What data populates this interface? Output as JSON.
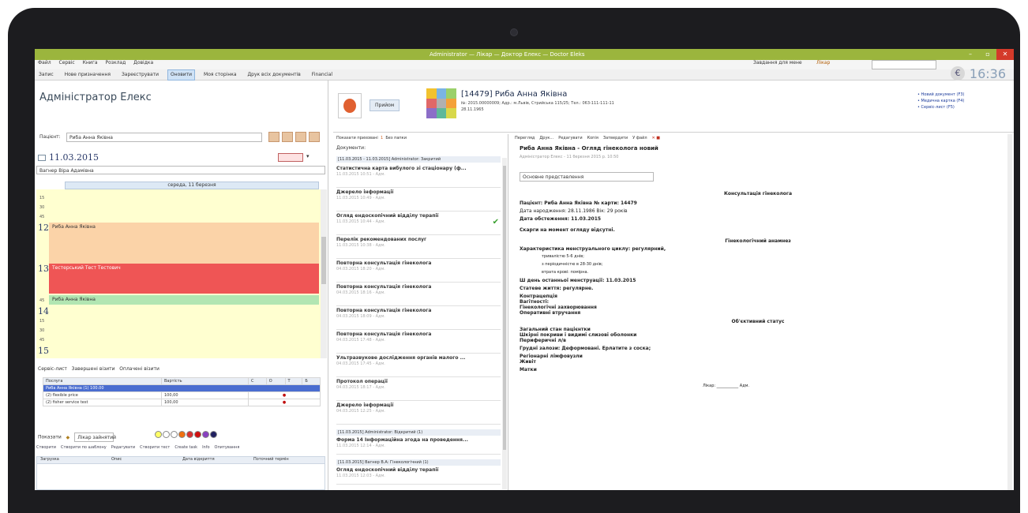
{
  "window": {
    "title": "Administrator — Лікар — Доктор Елекс — Doctor Eleks"
  },
  "menu": {
    "items": [
      "Файл",
      "Сервіс",
      "Книга",
      "Розклад",
      "Довідка"
    ]
  },
  "toolbar": {
    "items": [
      "Запис",
      "Нове призначення",
      "Зареєструвати",
      "Оновити",
      "Моя сторінка",
      "Друк всіх документів",
      "Financial"
    ]
  },
  "top_right": {
    "today_label": "Завдання для мене",
    "user": "Лікар",
    "clock": "16:36",
    "links": [
      "Новий документ (F3)",
      "Медична картка (F4)",
      "Сервіс-лист (F5)"
    ]
  },
  "left": {
    "header": "Адміністратор Елекс",
    "patient_label": "Пацієнт:",
    "patient_value": "Риба Анна Яківна",
    "date": "11.03.2015",
    "doctor_select": "Вагнер Віра Адамівна",
    "day_header": "середа, 11 березня",
    "hours": [
      "12",
      "13",
      "14",
      "15"
    ],
    "minutes": [
      "15",
      "30",
      "45"
    ],
    "appointments": [
      "Риба Анна Яківна",
      "Тестерський Тест Тестович",
      "Риба Анна Яківна"
    ],
    "services_tabs": [
      "Сервіс-лист",
      "Завершені візити",
      "Оплачені візити"
    ],
    "services_table": {
      "columns": [
        "Послуга",
        "Вартість",
        "С",
        "О",
        "Т",
        "Б"
      ],
      "group_row": "Риба Анна Яківна (1) 100.00",
      "rows": [
        {
          "name": "(2) flexible price",
          "price": "100,00"
        },
        {
          "name": "(2) fisher service test",
          "price": "100,00"
        }
      ]
    },
    "show_label": "Показати",
    "doctor_filter": "Лікар зайнятий",
    "colors": [
      "#ffff66",
      "#ffffff",
      "#ffffff",
      "#f07010",
      "#d83030",
      "#d01010",
      "#8840c0",
      "#202060"
    ],
    "bottom_toolbar": [
      "Створити",
      "Створити по шаблону",
      "Редагувати",
      "Створити тест",
      "Create task",
      "Info",
      "Опитування"
    ],
    "bottom_columns": [
      "Загрузка",
      "Опис",
      "Дата відкриття",
      "Поточний термін"
    ]
  },
  "patient": {
    "name": "[14479] Риба Анна Яківна",
    "details": "№: 2015.00000009; Адр.: м.Львів, Стрийська 115/25; Тел.: 063-111-111-11",
    "dob": "28.11.1965",
    "history_button": "Прийом"
  },
  "middle": {
    "toolbar": [
      "Показати приховані",
      "1",
      "Без папки"
    ],
    "section_label": "Документи:",
    "group1": "[11.03.2015 - 11.03.2015] Administrator: Закритий",
    "items": [
      {
        "title": "Статистична карта вибулого зі стаціонару (ф...",
        "sub": "11.03.2015 10:51 - Адм."
      },
      {
        "title": "Джерело інформації",
        "sub": "11.03.2015 10:49 - Адм."
      },
      {
        "title": "Огляд ендоскопічний відділу терапії",
        "sub": "11.03.2015 10:44 - Адм."
      },
      {
        "title": "Перелік рекомендованих послуг",
        "sub": "11.03.2015 10:38 - Адм."
      },
      {
        "title": "Повторна консультація гінеколога",
        "sub": "04.03.2015 18:20 - Адм."
      },
      {
        "title": "Повторна консультація гінеколога",
        "sub": "04.03.2015 18:16 - Адм."
      },
      {
        "title": "Повторна консультація гінеколога",
        "sub": "04.03.2015 18:09 - Адм."
      },
      {
        "title": "Повторна консультація гінеколога",
        "sub": "04.03.2015 17:48 - Адм."
      },
      {
        "title": "Ультразвукове дослідження органів малого ...",
        "sub": "04.03.2015 17:45 - Адм."
      },
      {
        "title": "Протокол операції",
        "sub": "04.03.2015 18:17 - Адм."
      },
      {
        "title": "Джерело інформації",
        "sub": "04.03.2015 12:25 - Адм."
      }
    ],
    "group2": "[11.03.2015] Administrator: Відкритий (1)",
    "item_after_group2": {
      "title": "Форма 14 Інформаційна згода на проведення...",
      "sub": "11.03.2015 12:14 - Адм."
    },
    "group3": "[11.03.2015] Вагнер В.А: Гінекологічний (1)",
    "item_after_group3": {
      "title": "Огляд ендоскопічний відділу терапії",
      "sub": "11.03.2015 12:03 - Адм."
    }
  },
  "document": {
    "toolbar": [
      "Перегляд",
      "Друк...",
      "Редагувати",
      "Копія",
      "Затвердити",
      "У файл"
    ],
    "title": "Риба Анна Яківна - Огляд гінеколога новий",
    "subtitle": "Адміністратор Елекс - 11 березня 2015 р. 10:50",
    "view_select": "Основне представлення",
    "heading": "Консультація гінеколога",
    "patient_line": "Пацієнт: Риба Анна Яківна   № карти: 14479",
    "dob_line": "Дата народження: 28.11.1986   Вік: 29 років",
    "exam_date": "Дата обстеження: 11.03.2015",
    "complaints": "Скарги на момент огляду відсутні.",
    "history_heading": "Гінекологічний анамнез",
    "cycle_line": "Характеристика менструального циклу: регулярний,",
    "cycle_details": [
      "тривалістю 5-6 днів;",
      "з періодичністю в 28-30 днів;",
      "втрата крові: помірна."
    ],
    "last_period": "Ш день останньої менструації: 11.03.2015",
    "sex_life": "Статеве життя: регулярне.",
    "labels": [
      "Контрацепція",
      "Вагітності:",
      "Гінекологічні захворювання",
      "Оперативні втручання"
    ],
    "objective_heading": "Об'єктивний статус",
    "objective_labels": [
      "Загальний стан пацієнтки",
      "Шкірні покриви і видимі слизові оболонки",
      "Периферичні л/в"
    ],
    "breast_line": "Грудні залози: Деформовані. Ерлатите з соска;",
    "more_labels": [
      "Регіонарні лімфовузли",
      "Живіт",
      "Матки"
    ],
    "signature": "Лікар: ___________ Адм."
  }
}
